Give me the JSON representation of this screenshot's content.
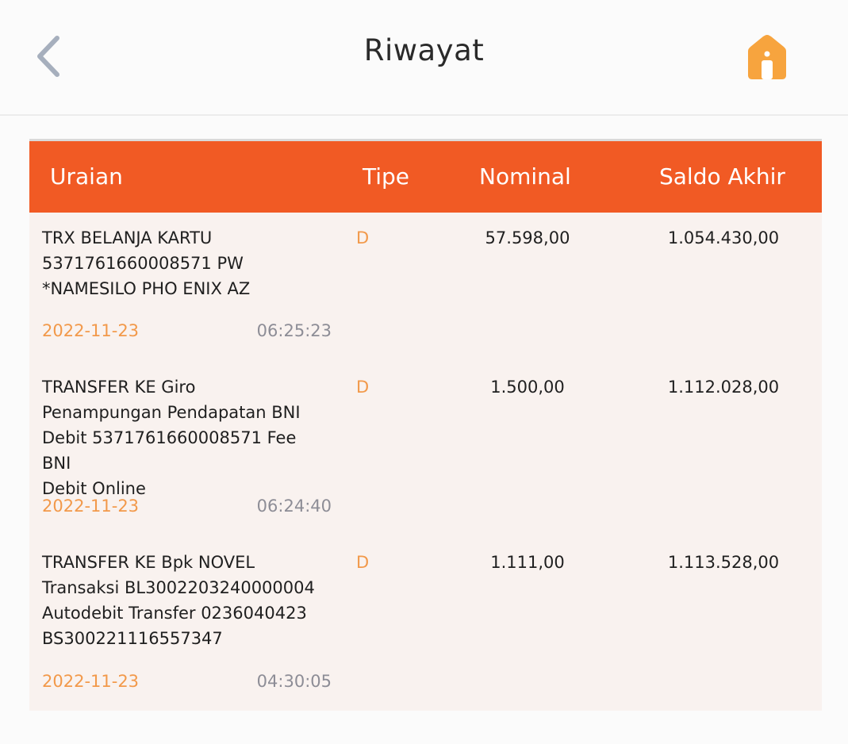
{
  "header": {
    "title": "Riwayat",
    "back_icon": "chevron-left-icon",
    "home_icon": "home-icon"
  },
  "colors": {
    "accent": "#f15a24",
    "home_icon": "#f7a43e",
    "date_text": "#f2994a",
    "time_text": "#8d8d96",
    "table_bg": "#f9f2ef"
  },
  "table": {
    "columns": [
      "Uraian",
      "Tipe",
      "Nominal",
      "Saldo Akhir"
    ],
    "rows": [
      {
        "desc_lines": [
          "TRX BELANJA KARTU",
          "5371761660008571 PW",
          "*NAMESILO PHO ENIX AZ"
        ],
        "tipe": "D",
        "nominal": "57.598,00",
        "saldo": "1.054.430,00",
        "date": "2022-11-23",
        "time": "06:25:23"
      },
      {
        "desc_lines": [
          "TRANSFER KE Giro",
          "Penampungan Pendapatan BNI",
          "Debit 5371761660008571 Fee BNI",
          "Debit Online"
        ],
        "tipe": "D",
        "nominal": "1.500,00",
        "saldo": "1.112.028,00",
        "date": "2022-11-23",
        "time": "06:24:40"
      },
      {
        "desc_lines": [
          "TRANSFER KE Bpk NOVEL",
          "Transaksi BL3002203240000004",
          "Autodebit Transfer 0236040423",
          "BS300221116557347"
        ],
        "tipe": "D",
        "nominal": "1.111,00",
        "saldo": "1.113.528,00",
        "date": "2022-11-23",
        "time": "04:30:05"
      }
    ]
  }
}
